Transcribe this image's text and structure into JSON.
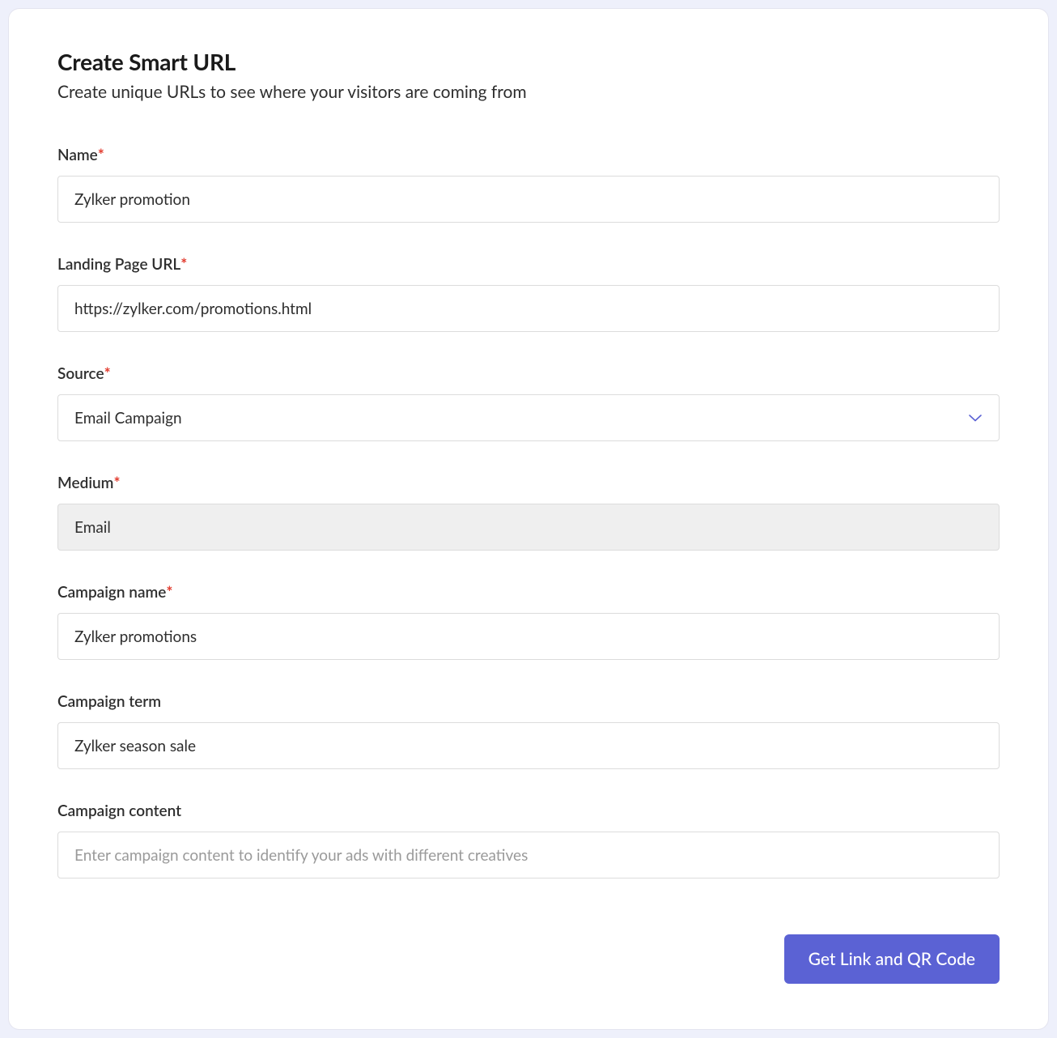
{
  "header": {
    "title": "Create Smart URL",
    "subtitle": "Create unique URLs to see where your visitors are coming from"
  },
  "fields": {
    "name": {
      "label": "Name",
      "required": true,
      "value": "Zylker promotion"
    },
    "landing_url": {
      "label": "Landing Page URL",
      "required": true,
      "value": "https://zylker.com/promotions.html"
    },
    "source": {
      "label": "Source",
      "required": true,
      "value": "Email Campaign"
    },
    "medium": {
      "label": "Medium",
      "required": true,
      "value": "Email"
    },
    "campaign_name": {
      "label": "Campaign name",
      "required": true,
      "value": "Zylker promotions"
    },
    "campaign_term": {
      "label": "Campaign term",
      "required": false,
      "value": "Zylker season sale"
    },
    "campaign_content": {
      "label": "Campaign content",
      "required": false,
      "value": "",
      "placeholder": "Enter campaign content to identify your ads with different creatives"
    }
  },
  "buttons": {
    "submit": "Get Link and QR Code"
  },
  "required_marker": "*"
}
